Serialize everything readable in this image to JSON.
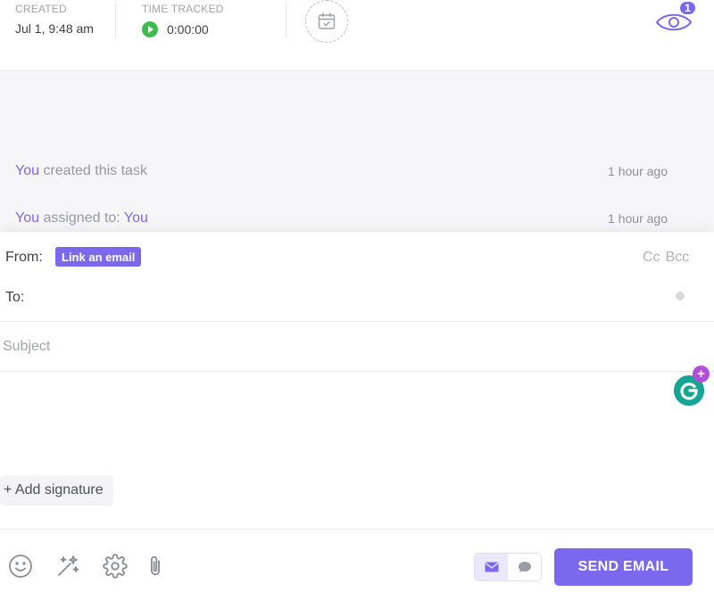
{
  "meta": {
    "created_label": "CREATED",
    "created_value": "Jul 1, 9:48 am",
    "time_label": "TIME TRACKED",
    "time_value": "0:00:00",
    "calendar_icon": "calendar-check-icon",
    "watchers_icon": "eye-icon",
    "watchers_count": "1"
  },
  "activity": [
    {
      "actor": "You",
      "text": " created this task",
      "target": "",
      "time": "1 hour ago"
    },
    {
      "actor": "You",
      "text": " assigned to: ",
      "target": "You",
      "time": "1 hour ago"
    }
  ],
  "composer": {
    "from_label": "From:",
    "link_email_label": "Link an email",
    "cc_label": "Cc",
    "bcc_label": "Bcc",
    "to_label": "To:",
    "to_value": "",
    "subject_placeholder": "Subject",
    "subject_value": "",
    "add_signature_label": "+ Add signature",
    "send_label": "SEND EMAIL"
  },
  "colors": {
    "accent": "#7b68ee",
    "play": "#3ebd4e",
    "grammarly": "#15a595",
    "grammarly_plus": "#b24fd9"
  },
  "icons": {
    "toolbar": [
      "emoji-icon",
      "magic-wand-icon",
      "gear-icon",
      "paperclip-icon"
    ],
    "toggle": [
      "envelope-icon",
      "chat-bubble-icon"
    ]
  }
}
